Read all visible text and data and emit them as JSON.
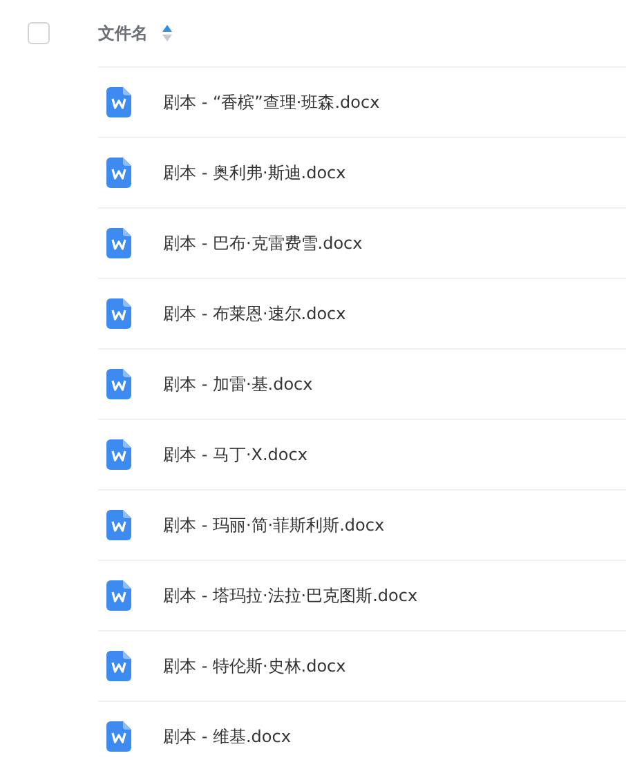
{
  "header": {
    "select_all": {
      "checked": false
    },
    "column": "文件名",
    "sort_ascending": true
  },
  "files": [
    {
      "name": "剧本 - “香槟”查理·班森.docx"
    },
    {
      "name": "剧本 - 奥利弗·斯迪.docx"
    },
    {
      "name": "剧本 - 巴布·克雷费雪.docx"
    },
    {
      "name": "剧本 - 布莱恩·速尔.docx"
    },
    {
      "name": "剧本 - 加雷·基.docx"
    },
    {
      "name": "剧本 - 马丁·X.docx"
    },
    {
      "name": "剧本 - 玛丽·简·菲斯利斯.docx"
    },
    {
      "name": "剧本 - 塔玛拉·法拉·巴克图斯.docx"
    },
    {
      "name": "剧本 - 特伦斯·史林.docx"
    },
    {
      "name": "剧本 - 维基.docx"
    }
  ]
}
